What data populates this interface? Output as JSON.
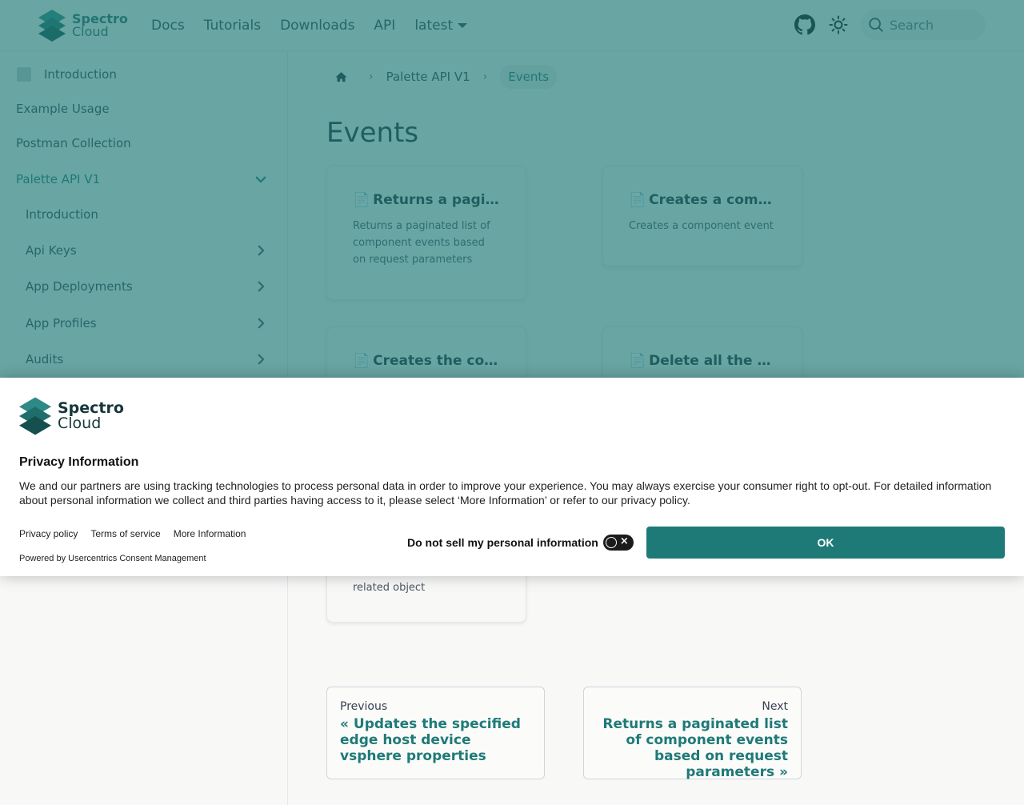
{
  "brand": {
    "line1": "Spectro",
    "line2": "Cloud",
    "color": "#2a6b6a"
  },
  "nav": {
    "links": [
      "Docs",
      "Tutorials",
      "Downloads",
      "API"
    ],
    "version": "latest",
    "search_placeholder": "Search"
  },
  "sidebar": {
    "items": [
      {
        "label": "Introduction",
        "icon": "doc-icon"
      },
      {
        "label": "Example Usage"
      },
      {
        "label": "Postman Collection"
      },
      {
        "label": "Palette API V1",
        "expanded": true
      },
      {
        "label": "Introduction"
      },
      {
        "label": "Api Keys"
      },
      {
        "label": "App Deployments"
      },
      {
        "label": "App Profiles"
      },
      {
        "label": "Audits"
      }
    ]
  },
  "breadcrumb": {
    "parent": "Palette API V1",
    "current": "Events"
  },
  "page": {
    "title": "Events"
  },
  "cards": [
    {
      "icon": "📄",
      "title": "Returns a paginate…",
      "desc": "Returns a paginated list of component events based on request parameters"
    },
    {
      "icon": "📄",
      "title": "Creates a compon…",
      "desc": "Creates a component event"
    },
    {
      "icon": "📄",
      "title": "Creates the compo…",
      "desc": ""
    },
    {
      "icon": "📄",
      "title": "Delete all the comp…",
      "desc": ""
    }
  ],
  "card_tail_text": "related object",
  "pager": {
    "prev_label": "Previous",
    "prev_title": "« Updates the specified edge host device vsphere properties",
    "next_label": "Next",
    "next_title": "Returns a paginated list of component events based on request parameters »"
  },
  "consent": {
    "logo_line1": "Spectro",
    "logo_line2": "Cloud",
    "title": "Privacy Information",
    "text": "We and our partners are using tracking technologies to process personal data in order to improve your experience. You may always exercise your consumer right to opt-out. For detailed information about personal information we collect and third parties having access to it, please select ‘More Information’ or refer to our privacy policy.",
    "links": [
      "Privacy policy",
      "Terms of service",
      "More Information"
    ],
    "powered_by": "Powered by Usercentrics Consent Management",
    "optout_label": "Do not sell my personal information",
    "ok_label": "OK",
    "accent": "#1e7a77"
  }
}
